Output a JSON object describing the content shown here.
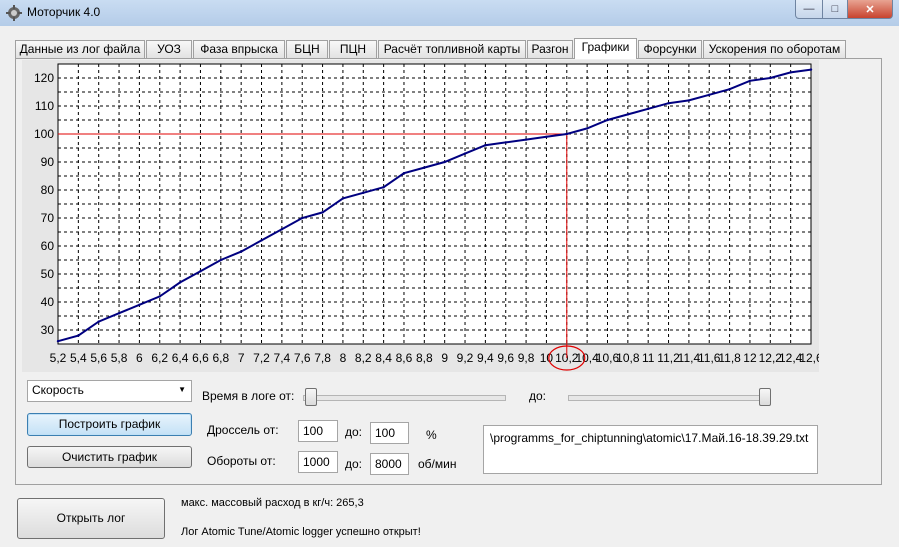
{
  "window": {
    "title": "Моторчик 4.0"
  },
  "tabs": [
    {
      "label": "Данные из лог файла"
    },
    {
      "label": "УОЗ"
    },
    {
      "label": "Фаза впрыска"
    },
    {
      "label": "БЦН"
    },
    {
      "label": "ПЦН"
    },
    {
      "label": "Расчёт топливной карты"
    },
    {
      "label": "Разгон"
    },
    {
      "label": "Графики"
    },
    {
      "label": "Форсунки"
    },
    {
      "label": "Ускорения по оборотам"
    }
  ],
  "active_tab": "Графики",
  "chart_data": {
    "type": "line",
    "x": [
      5.2,
      5.4,
      5.6,
      5.8,
      6.0,
      6.2,
      6.4,
      6.6,
      6.8,
      7.0,
      7.2,
      7.4,
      7.6,
      7.8,
      8.0,
      8.2,
      8.4,
      8.6,
      8.8,
      9.0,
      9.2,
      9.4,
      9.6,
      9.8,
      10.0,
      10.2,
      10.4,
      10.6,
      10.8,
      11.0,
      11.2,
      11.4,
      11.6,
      11.8,
      12.0,
      12.2,
      12.4,
      12.6
    ],
    "series": [
      {
        "values": [
          26,
          28,
          33,
          36,
          39,
          42,
          47,
          51,
          55,
          58,
          62,
          66,
          70,
          72,
          77,
          79,
          81,
          86,
          88,
          90,
          93,
          96,
          97,
          98,
          99,
          100,
          102,
          105,
          107,
          109,
          111,
          112,
          114,
          116,
          119,
          120,
          122,
          123
        ],
        "color": "#000080"
      }
    ],
    "x_tick_labels": [
      "5,2",
      "5,4",
      "5,6",
      "5,8",
      "6",
      "6,2",
      "6,4",
      "6,6",
      "6,8",
      "7",
      "7,2",
      "7,4",
      "7,6",
      "7,8",
      "8",
      "8,2",
      "8,4",
      "8,6",
      "8,8",
      "9",
      "9,2",
      "9,4",
      "9,6",
      "9,8",
      "10",
      "10,2",
      "10,4",
      "10,6",
      "10,8",
      "11",
      "11,2",
      "11,4",
      "11,6",
      "11,8",
      "12",
      "12,2",
      "12,4",
      "12,6"
    ],
    "y_tick_labels": [
      "30",
      "40",
      "50",
      "60",
      "70",
      "80",
      "90",
      "100",
      "110",
      "120"
    ],
    "ylim": [
      25,
      125
    ],
    "xlim": [
      5.2,
      12.6
    ],
    "grid": true,
    "marker": {
      "x": 10.2,
      "y": 100,
      "color": "#e00000"
    }
  },
  "controls": {
    "param_select": "Скорость",
    "build_button": "Построить график",
    "clear_button": "Очистить график",
    "time_from_label": "Время в логе от:",
    "time_to_label": "до:",
    "throttle_label": "Дроссель от:",
    "throttle_from": "100",
    "throttle_to_label": "до:",
    "throttle_to": "100",
    "throttle_unit": "%",
    "rpm_label": "Обороты от:",
    "rpm_from": "1000",
    "rpm_to_label": "до:",
    "rpm_to": "8000",
    "rpm_unit": "об/мин",
    "file_path": "\\programms_for_chiptunning\\atomic\\17.Май.16-18.39.29.txt"
  },
  "bottom": {
    "open_log_button": "Открыть лог",
    "max_flow_text": "макс. массовый расход в кг/ч: 265,3",
    "status_text": "Лог Atomic Tune/Atomic logger успешно открыт!"
  }
}
